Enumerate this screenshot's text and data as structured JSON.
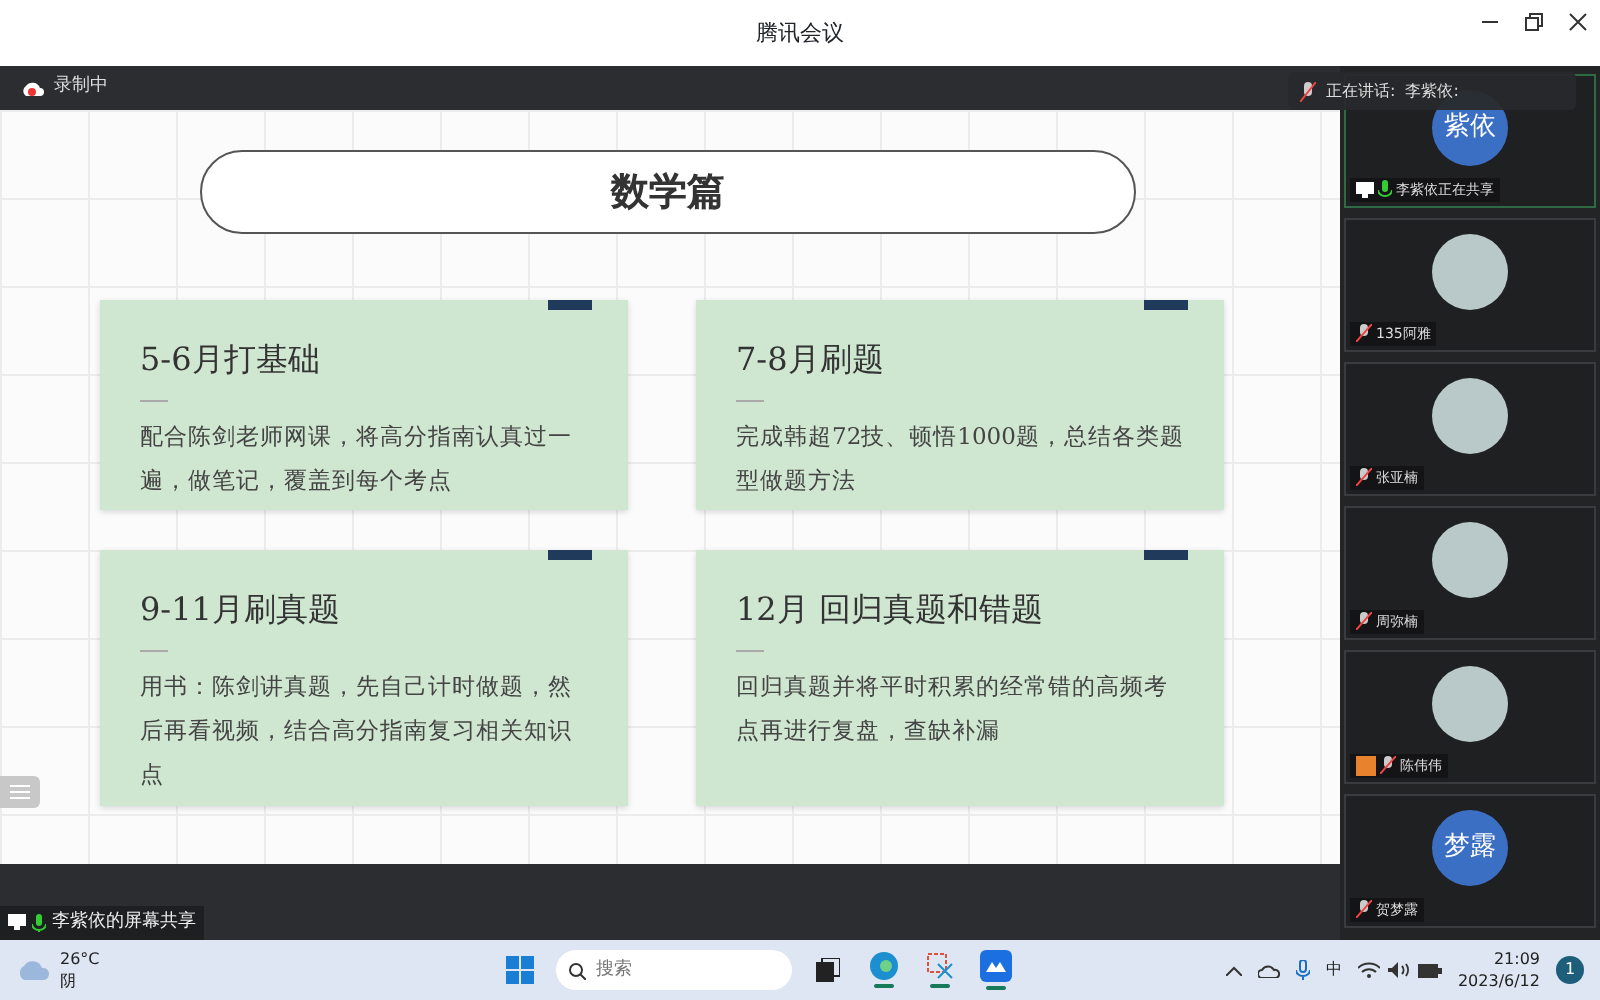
{
  "window": {
    "title": "腾讯会议"
  },
  "recording": {
    "label": "录制中"
  },
  "speaking": {
    "label": "正在讲话:",
    "name": "李紫依:"
  },
  "slide": {
    "title": "数学篇",
    "cards": [
      {
        "heading": "5-6月打基础",
        "body": "配合陈剑老师网课，将高分指南认真过一遍，做笔记，覆盖到每个考点"
      },
      {
        "heading": "7-8月刷题",
        "body": "完成韩超72技、顿悟1000题，总结各类题型做题方法"
      },
      {
        "heading": "9-11月刷真题",
        "body": "用书：陈剑讲真题，先自己计时做题，然后再看视频，结合高分指南复习相关知识点"
      },
      {
        "heading": "12月  回归真题和错题",
        "body": "回归真题并将平时积累的经常错的高频考点再进行复盘，查缺补漏"
      }
    ]
  },
  "share_label": "李紫依的屏幕共享",
  "participants": [
    {
      "kind": "text",
      "avatar_text": "紫依",
      "name": "李紫依正在共享",
      "muted": false,
      "sharing": true,
      "host": false,
      "active": true
    },
    {
      "kind": "photo",
      "name": "135阿雅",
      "muted": true,
      "sharing": false,
      "host": false,
      "active": false
    },
    {
      "kind": "photo",
      "name": "张亚楠",
      "muted": true,
      "sharing": false,
      "host": false,
      "active": false
    },
    {
      "kind": "photo",
      "name": "周弥楠",
      "muted": true,
      "sharing": false,
      "host": false,
      "active": false
    },
    {
      "kind": "photo",
      "name": "陈伟伟",
      "muted": true,
      "sharing": false,
      "host": true,
      "active": false
    },
    {
      "kind": "text",
      "avatar_text": "梦露",
      "name": "贺梦露",
      "muted": true,
      "sharing": false,
      "host": false,
      "active": false
    }
  ],
  "taskbar": {
    "temperature": "26°C",
    "condition": "阴",
    "search_placeholder": "搜索",
    "apps": [
      {
        "kind": "start",
        "running": false
      },
      {
        "kind": "taskview",
        "running": false
      },
      {
        "kind": "browser",
        "running": true
      },
      {
        "kind": "snip",
        "running": true
      },
      {
        "kind": "meeting",
        "running": true
      }
    ],
    "ime": "中",
    "time": "21:09",
    "date": "2023/6/12",
    "notifications": "1"
  }
}
